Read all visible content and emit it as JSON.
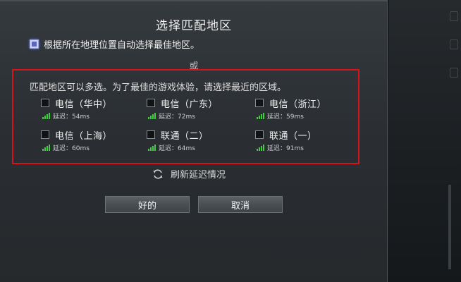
{
  "dialog": {
    "title": "选择匹配地区",
    "auto_select_label": "根据所在地理位置自动选择最佳地区。",
    "auto_select_checked": true,
    "or_text": "或",
    "instruction": "匹配地区可以多选。为了最佳的游戏体验，请选择最近的区域。",
    "regions": [
      {
        "name": "电信（华中）",
        "latency": "延迟：54ms",
        "checked": false
      },
      {
        "name": "电信（广东）",
        "latency": "延迟：72ms",
        "checked": false
      },
      {
        "name": "电信（浙江）",
        "latency": "延迟：59ms",
        "checked": false
      },
      {
        "name": "电信（上海）",
        "latency": "延迟：60ms",
        "checked": false
      },
      {
        "name": "联通（二）",
        "latency": "延迟：64ms",
        "checked": false
      },
      {
        "name": "联通（一）",
        "latency": "延迟：91ms",
        "checked": false
      }
    ],
    "refresh_label": "刷新延迟情况",
    "ok_label": "好的",
    "cancel_label": "取消"
  },
  "colors": {
    "highlight_border": "#d8131b",
    "signal": "#3fcf3f",
    "dialog_bg": "#2f3337"
  },
  "icons": {
    "refresh": "refresh-icon",
    "signal": "signal-bars-icon"
  }
}
